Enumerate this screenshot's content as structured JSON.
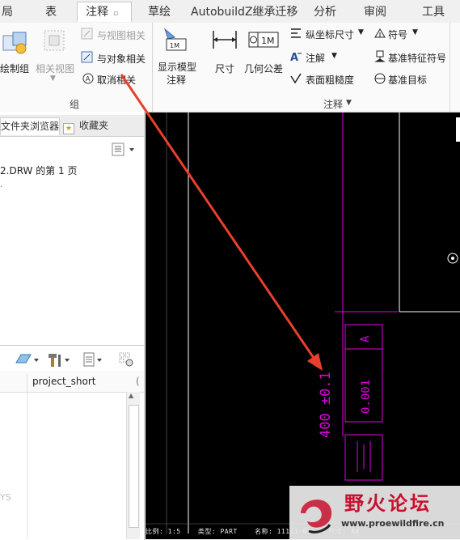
{
  "tabs": [
    {
      "label": "局"
    },
    {
      "label": "表"
    },
    {
      "label": "注释",
      "active": true
    },
    {
      "label": "草绘"
    },
    {
      "label": "AutobuildZ继承迁移"
    },
    {
      "label": "分析"
    },
    {
      "label": "审阅"
    },
    {
      "label": "工具"
    }
  ],
  "ribbon": {
    "draw_group": {
      "label": "绘制组"
    },
    "related_view": {
      "label": "相关视图"
    },
    "relate_to_view": {
      "label": "与视图相关"
    },
    "relate_to_object": {
      "label": "与对象相关"
    },
    "unrelate": {
      "label": "取消相关"
    },
    "group_label": "组",
    "show_model_annotation": {
      "line1": "显示模型",
      "line2": "注释"
    },
    "dimension": {
      "label": "尺寸"
    },
    "geometric_tolerance": {
      "label": "几何公差"
    },
    "ordinate_dimension": {
      "label": "纵坐标尺寸"
    },
    "note": {
      "label": "注解"
    },
    "surface_finish": {
      "label": "表面粗糙度"
    },
    "symbol": {
      "label": "符号"
    },
    "datum_feature_symbol": {
      "label": "基准特征符号"
    },
    "datum_target": {
      "label": "基准目标"
    },
    "annotation_group_label": "注释"
  },
  "left_panel": {
    "tab_browser": "文件夹浏览器",
    "tab_favorites": "收藏夹",
    "tree_item": "2.DRW 的第 1 页",
    "column_header": "project_short",
    "column_header_more": "(",
    "faint_text": "YS"
  },
  "drawing": {
    "dimension_text": "400 ±0.1",
    "datum_letter": "A",
    "tolerance_value": "0.001",
    "status_bar": "比例: 1:5    类型: PART    名称: 11111-02    尺寸: A4"
  },
  "watermark": {
    "title": "野火论坛",
    "url": "www.proewildfire.cn"
  },
  "colors": {
    "annotation_magenta": "#e000e0",
    "arrow_red": "#e8402c",
    "canvas_bg": "#000000",
    "watermark_red": "#c8102e"
  }
}
